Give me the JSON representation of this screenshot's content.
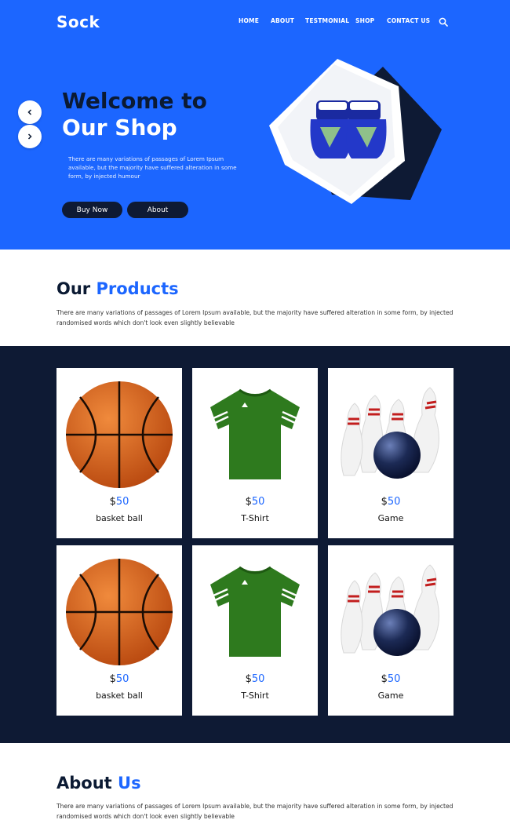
{
  "brand": {
    "logo": "Sock"
  },
  "nav": {
    "items": [
      "HOME",
      "ABOUT",
      "TESTMONIAL",
      "SHOP",
      "CONTACT US"
    ]
  },
  "hero": {
    "title_line1": "Welcome to",
    "title_line2": "Our Shop",
    "description": "There are many variations of passages of Lorem Ipsum available, but the majority have suffered alteration in some form, by injected humour",
    "buy_label": "Buy Now",
    "about_label": "About",
    "image": "boxing-gloves-icon"
  },
  "products": {
    "title_dark": "Our ",
    "title_blue": "Products",
    "description": "There are many variations of passages of Lorem Ipsum available, but the majority have suffered alteration in some form, by injected randomised words which don't look even slightly believable",
    "items": [
      {
        "currency": "$",
        "price": "50",
        "name": "basket ball",
        "icon": "basketball-icon"
      },
      {
        "currency": "$",
        "price": "50",
        "name": "T-Shirt",
        "icon": "tshirt-icon"
      },
      {
        "currency": "$",
        "price": "50",
        "name": "Game",
        "icon": "bowling-icon"
      },
      {
        "currency": "$",
        "price": "50",
        "name": "basket ball",
        "icon": "basketball-icon"
      },
      {
        "currency": "$",
        "price": "50",
        "name": "T-Shirt",
        "icon": "tshirt-icon"
      },
      {
        "currency": "$",
        "price": "50",
        "name": "Game",
        "icon": "bowling-icon"
      }
    ]
  },
  "about": {
    "title_dark": "About ",
    "title_blue": "Us",
    "description": "There are many variations of passages of Lorem Ipsum available, but the majority have suffered alteration in some form, by injected randomised words which don't look even slightly believable"
  },
  "colors": {
    "accent": "#1c66ff",
    "dark": "#0e1a34"
  }
}
